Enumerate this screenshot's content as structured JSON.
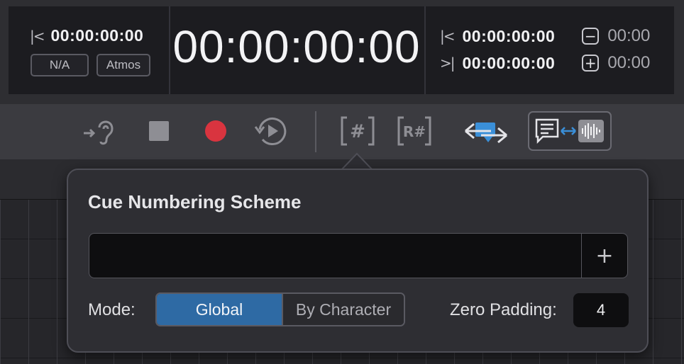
{
  "timecode": {
    "left_in_value": "00:00:00:00",
    "chip_na": "N/A",
    "chip_atmos": "Atmos",
    "main_value": "00:00:00:00",
    "right_in_value": "00:00:00:00",
    "right_out_value": "00:00:00:00",
    "minus_offset": "00:00",
    "plus_offset": "00:00"
  },
  "toolbar": {
    "icons": [
      "listen-icon",
      "stop-icon",
      "record-icon",
      "replay-icon",
      "cue-number-icon",
      "renumber-icon",
      "swap-icon",
      "transcript-audio-icon"
    ],
    "cue_number_label": "[#]",
    "renumber_label": "R#",
    "record_color": "#d9343f",
    "accent_color": "#3a8fd8"
  },
  "popover": {
    "title": "Cue Numbering Scheme",
    "scheme_value": "",
    "add_label": "+",
    "mode_label": "Mode:",
    "mode_options": [
      "Global",
      "By Character"
    ],
    "mode_selected": "Global",
    "zero_padding_label": "Zero Padding:",
    "zero_padding_value": "4"
  }
}
